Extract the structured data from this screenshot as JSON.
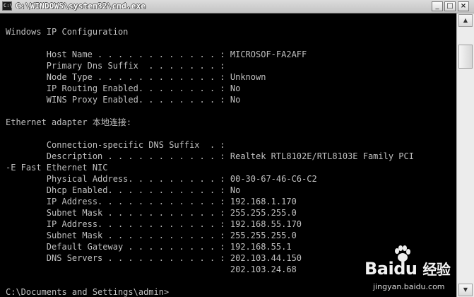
{
  "window": {
    "title": "C:\\WINDOWS\\system32\\cmd.exe",
    "icon": "console-icon",
    "buttons": {
      "minimize": "_",
      "maximize": "□",
      "close": "×"
    }
  },
  "console": {
    "lines": [
      {
        "text": "Windows IP Configuration"
      },
      {
        "text": "        Host Name . . . . . . . . . . . . : MICROSOF-FA2AFF"
      },
      {
        "text": "        Primary Dns Suffix  . . . . . . . :"
      },
      {
        "text": "        Node Type . . . . . . . . . . . . : Unknown"
      },
      {
        "text": "        IP Routing Enabled. . . . . . . . : No"
      },
      {
        "text": "        WINS Proxy Enabled. . . . . . . . : No"
      },
      {
        "text": "Ethernet adapter 本地连接:"
      },
      {
        "text": "        Connection-specific DNS Suffix  . :"
      },
      {
        "text": "        Description . . . . . . . . . . . : Realtek RTL8102E/RTL8103E Family PCI"
      },
      {
        "text": "-E Fast Ethernet NIC"
      },
      {
        "text": "        Physical Address. . . . . . . . . : 00-30-67-46-C6-C2"
      },
      {
        "text": "        Dhcp Enabled. . . . . . . . . . . : No"
      },
      {
        "text": "        IP Address. . . . . . . . . . . . : 192.168.1.170"
      },
      {
        "text": "        Subnet Mask . . . . . . . . . . . : 255.255.255.0"
      },
      {
        "text": "        IP Address. . . . . . . . . . . . : 192.168.55.170"
      },
      {
        "text": "        Subnet Mask . . . . . . . . . . . : 255.255.255.0"
      },
      {
        "text": "        Default Gateway . . . . . . . . . : 192.168.55.1"
      },
      {
        "text": "        DNS Servers . . . . . . . . . . . : 202.103.44.150"
      },
      {
        "text": "                                            202.103.24.68"
      },
      {
        "text": "C:\\Documents and Settings\\admin>"
      }
    ]
  },
  "scrollbar": {
    "up": "▲",
    "down": "▼"
  },
  "watermark": {
    "brand": "Bai",
    "brand2": "du",
    "product": "经验",
    "url": "jingyan.baidu.com"
  }
}
